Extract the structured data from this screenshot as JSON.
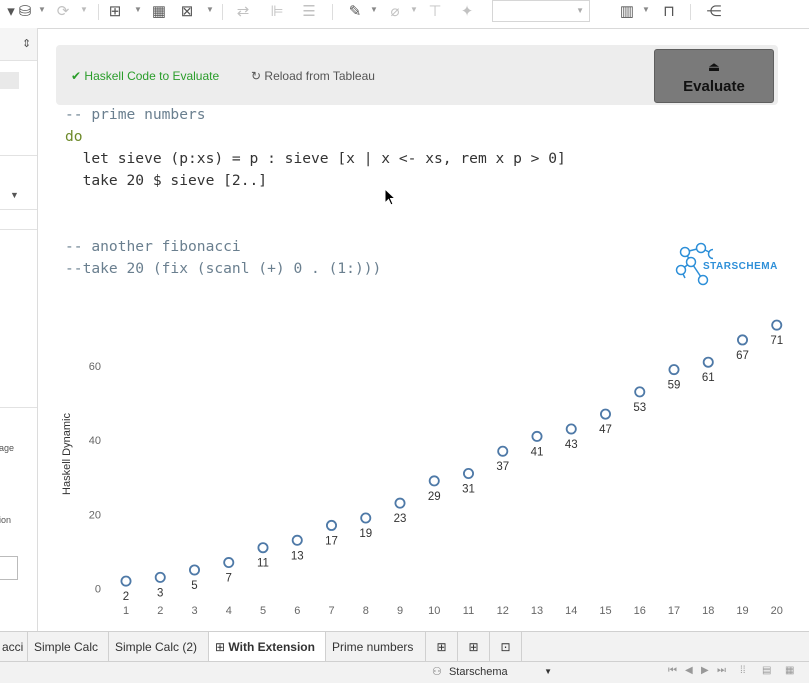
{
  "extension": {
    "status_label": "Haskell Code to Evaluate",
    "reload_label": "Reload from Tableau",
    "evaluate_label": "Evaluate"
  },
  "code_lines": [
    "-- prime numbers",
    "do",
    "  let sieve (p:xs) = p : sieve [x | x <- xs, rem x p > 0]",
    "  take 20 $ sieve [2..]",
    "",
    "",
    "-- another fibonacci",
    "--take 20 (fix (scanl (+) 0 . (1:)))"
  ],
  "logo": {
    "text": "STARSCHEMA",
    "color": "#2d8fd8"
  },
  "left_panel": {
    "fragment_1": "age",
    "fragment_2": "ion"
  },
  "chart_data": {
    "type": "scatter",
    "ylabel": "Haskell Dynamic",
    "xlabel": "",
    "x": [
      1,
      2,
      3,
      4,
      5,
      6,
      7,
      8,
      9,
      10,
      11,
      12,
      13,
      14,
      15,
      16,
      17,
      18,
      19,
      20
    ],
    "y": [
      2,
      3,
      5,
      7,
      11,
      13,
      17,
      19,
      23,
      29,
      31,
      37,
      41,
      43,
      47,
      53,
      59,
      61,
      67,
      71
    ],
    "point_labels": [
      "2",
      "3",
      "5",
      "7",
      "11",
      "13",
      "17",
      "19",
      "23",
      "29",
      "31",
      "37",
      "41",
      "43",
      "47",
      "53",
      "59",
      "61",
      "67",
      "71"
    ],
    "x_ticks": [
      "1",
      "2",
      "3",
      "4",
      "5",
      "6",
      "7",
      "8",
      "9",
      "10",
      "11",
      "12",
      "13",
      "14",
      "15",
      "16",
      "17",
      "18",
      "19",
      "20"
    ],
    "y_ticks": [
      0,
      20,
      40,
      60
    ],
    "ylim": [
      0,
      72
    ],
    "marker_color": "#4e79a7",
    "grid": false
  },
  "tabs": [
    {
      "label": "acci",
      "active": false
    },
    {
      "label": "Simple Calc",
      "active": false
    },
    {
      "label": "Simple Calc (2)",
      "active": false
    },
    {
      "label": "With Extension",
      "active": true
    },
    {
      "label": "Prime numbers",
      "active": false
    }
  ],
  "status": {
    "user": "Starschema"
  }
}
